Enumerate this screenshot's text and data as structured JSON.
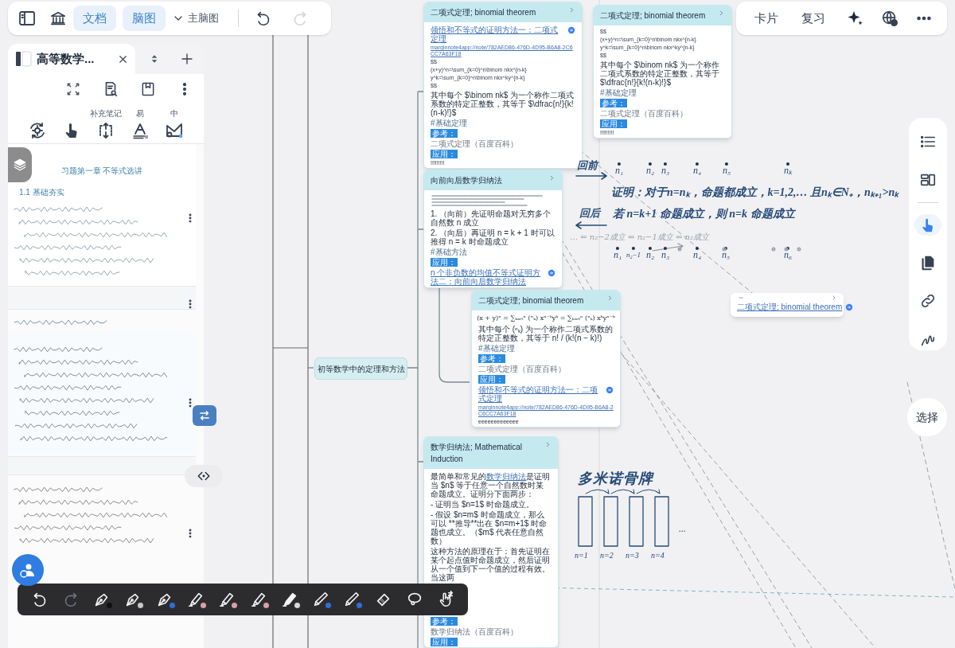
{
  "top_bar": {
    "tabs": [
      {
        "label": "文档",
        "active": true
      },
      {
        "label": "脑图",
        "active": true
      }
    ],
    "map_selector": "主脑图",
    "undo_disabled": false,
    "redo_disabled": true
  },
  "top_right": {
    "buttons": [
      "卡片",
      "复习"
    ]
  },
  "document": {
    "tab_title": "高等数学...",
    "tools": [
      {
        "kind": "rotate"
      },
      {
        "kind": "hand"
      },
      {
        "kind": "expand",
        "label": "补充笔记"
      },
      {
        "kind": "text",
        "label": "易"
      },
      {
        "kind": "shape",
        "label": "中"
      }
    ],
    "page_title": "习题第一章 不等式选讲",
    "section": "1.1 基础夯实"
  },
  "mind_map": {
    "root": "初等数学中的定理和方法",
    "cards": [
      {
        "title": "二项式定理; binomial theorem",
        "blocks": [
          {
            "kind": "link",
            "text": "领悟和不等式的证明方法一：二项式定理",
            "icon": true
          },
          {
            "kind": "url",
            "text": "marginnote4app://note/782AED86-476D-4D95-B6A8-2C6CC7A63F18"
          },
          {
            "kind": "code",
            "text": "$$"
          },
          {
            "kind": "code",
            "text": "(x+y)^n=\\sum_{k=0}^n\\binom nkx^{n-k}"
          },
          {
            "kind": "code",
            "text": "y^k=\\sum_{k=0}^n\\binom nkx^ky^{n-k}"
          },
          {
            "kind": "code",
            "text": "$$"
          },
          {
            "kind": "text",
            "text": "其中每个 $\\binom nk$ 为一个称作二项式系数的特定正整数，其等于 $\\dfrac{n!}{k!(n-k)!}$"
          },
          {
            "kind": "tag",
            "text": "#基础定理"
          },
          {
            "kind": "badge",
            "text": "参考："
          },
          {
            "kind": "source",
            "text": "二项式定理（百度百科）"
          },
          {
            "kind": "badge",
            "text": "应用："
          },
          {
            "kind": "marks",
            "text": "!!!!!!!!!"
          }
        ]
      },
      {
        "title": "二项式定理; binomial theorem",
        "blocks": [
          {
            "kind": "code",
            "text": "$$"
          },
          {
            "kind": "code",
            "text": "(x+y)^n=\\sum_{k=0}^n\\binom nkx^{n-k}"
          },
          {
            "kind": "code",
            "text": "y^k=\\sum_{k=0}^n\\binom nkx^ky^{n-k}"
          },
          {
            "kind": "code",
            "text": "$$"
          },
          {
            "kind": "text",
            "text": "其中每个 $\\binom nk$ 为一个称作二项式系数的特定正整数，其等于 $\\dfrac{n!}{k!(n-k)!}$"
          },
          {
            "kind": "tag",
            "text": "#基础定理"
          },
          {
            "kind": "badge",
            "text": "参考："
          },
          {
            "kind": "source",
            "text": "二项式定理（百度百科）"
          },
          {
            "kind": "badge",
            "text": "应用："
          },
          {
            "kind": "marks",
            "text": "!!!!!!!!!"
          }
        ]
      },
      {
        "title": "向前向后数学归纳法",
        "blocks": [
          {
            "kind": "small_text"
          },
          {
            "kind": "text",
            "text": "1. （向前）先证明命题对无穷多个自然数 n 成立"
          },
          {
            "kind": "text",
            "text": "2. （向后）再证明 n = k + 1 时可以推得 n = k 时命题成立"
          },
          {
            "kind": "tag",
            "text": "#基础方法"
          },
          {
            "kind": "badge",
            "text": "应用："
          },
          {
            "kind": "link",
            "text": "n 个非负数的均值不等式证明方法二：向前向后数学归纳法",
            "icon": true
          }
        ]
      },
      {
        "title": "二项式定理; binomial theorem",
        "blocks": [
          {
            "kind": "formula",
            "text": "(x + y)ⁿ = ∑ₖ₌₀ⁿ (ⁿₖ) xⁿ⁻ᵏyᵏ = ∑ₖ₌₀ⁿ (ⁿₖ) xᵏyⁿ⁻ᵏ"
          },
          {
            "kind": "text",
            "text": "其中每个 (ⁿₖ) 为一个称作二项式系数的特定正整数，其等于 n! / (k!(n − k)!)"
          },
          {
            "kind": "tag",
            "text": "#基础定理"
          },
          {
            "kind": "badge",
            "text": "参考："
          },
          {
            "kind": "source",
            "text": "二项式定理（百度百科）"
          },
          {
            "kind": "badge",
            "text": "应用："
          },
          {
            "kind": "link",
            "text": "领悟和不等式的证明方法一：二项式定理",
            "icon": true
          },
          {
            "kind": "url",
            "text": "marginnote4app://note/782AED86-476D-4D95-B6A8-2C6CC7A63F18"
          },
          {
            "kind": "marks",
            "text": "eeeeeeeeeeeee"
          }
        ]
      },
      {
        "title": "数学归纳法; Mathematical Induction",
        "blocks": [
          {
            "kind": "rich",
            "parts": [
              {
                "text": "最简单和常见的",
                "link": false
              },
              {
                "text": "数学归纳法",
                "link": true
              },
              {
                "text": "是证明当 $n$ 等于任意一个自然数时某命题成立。证明分下面两步：",
                "link": false
              }
            ]
          },
          {
            "kind": "text",
            "text": "- 证明当 $n=1$ 时命题成立。"
          },
          {
            "kind": "text",
            "text": "- 假设 $n=m$ 时命题成立，那么可以 **推导**出在 $n=m+1$ 时命题也成立。（$m$ 代表任意自然数）"
          },
          {
            "kind": "text",
            "text": "这种方法的原理在于：首先证明在某个起点值时命题成立，然后证明从一个值到下一个值的过程有效。当这两"
          },
          {
            "kind": "hidden_gap"
          },
          {
            "kind": "badge",
            "text": "参考："
          },
          {
            "kind": "source",
            "text": "数学归纳法（百度百科）"
          },
          {
            "kind": "badge",
            "text": "应用："
          }
        ]
      }
    ],
    "link_card": {
      "link": "二项式定理; binomial theorem"
    }
  },
  "handwriting": {
    "forward": "回前",
    "backward": "回后",
    "top_points": [
      "n₁",
      "n₂",
      "n₃",
      "n₄",
      "n₅",
      "nₖ"
    ],
    "proof": "证明：对于n=nₖ，命题都成立，k=1,2,… 且nₖ∈N₊，nₖ₊₁>nₖ",
    "backward_claim": "若 n=k+1 命题成立，则 n=k 命题成立",
    "chain": "… ⇐ n₂−2成立 ⇐ n₂−1成立 ⇐ n₂成立",
    "bottom_points": [
      "n₁",
      "n₂−1",
      "n₂",
      "n₃",
      "n₄",
      "n₅",
      "n₆"
    ],
    "domino_title": "多米诺骨牌",
    "dominoes": [
      "n=1",
      "n=2",
      "n=3",
      "n=4"
    ],
    "ellipsis": "..."
  },
  "side_tools": [
    {
      "kind": "outline",
      "selected": false
    },
    {
      "kind": "layout",
      "selected": false
    },
    {
      "kind": "hand",
      "selected": true
    },
    {
      "kind": "copy",
      "selected": false
    },
    {
      "kind": "link",
      "selected": false
    },
    {
      "kind": "squiggle",
      "selected": false
    }
  ],
  "select_button": "选择",
  "pen_tools": [
    {
      "kind": "undo",
      "disabled": false
    },
    {
      "kind": "redo",
      "disabled": true
    },
    {
      "kind": "pen",
      "color": "#111111",
      "disabled": false
    },
    {
      "kind": "pen",
      "color": "#c8c8c8",
      "disabled": false
    },
    {
      "kind": "pen",
      "color": "#2f6fd6",
      "disabled": false
    },
    {
      "kind": "highlighter",
      "color": "#d9a0a8",
      "disabled": false
    },
    {
      "kind": "highlighter",
      "color": "#d9a0a8",
      "disabled": false
    },
    {
      "kind": "highlighter",
      "color": "#d9a0a8",
      "disabled": false
    },
    {
      "kind": "marker",
      "color": "#d8d8d8",
      "disabled": false
    },
    {
      "kind": "pencil",
      "color": "#2f6fd6",
      "disabled": false
    },
    {
      "kind": "pencil",
      "color": "#2f6fd6",
      "disabled": false
    },
    {
      "kind": "eraser",
      "disabled": false
    },
    {
      "kind": "lasso",
      "disabled": false
    },
    {
      "kind": "gesture",
      "disabled": false
    }
  ]
}
